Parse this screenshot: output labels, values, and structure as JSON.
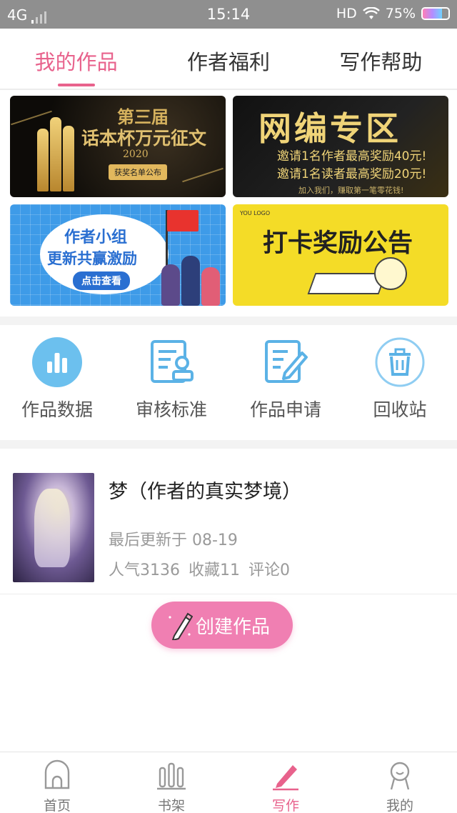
{
  "status_bar": {
    "network": "4G",
    "time": "15:14",
    "hd": "HD",
    "battery_percent": "75%",
    "battery_level": 0.75
  },
  "tabs": [
    {
      "label": "我的作品",
      "active": true
    },
    {
      "label": "作者福利",
      "active": false
    },
    {
      "label": "写作帮助",
      "active": false
    }
  ],
  "banners": {
    "contest": {
      "line1": "第三届",
      "line2": "话本杯万元征文",
      "year": "2020",
      "button": "获奖名单公布"
    },
    "editor_zone": {
      "title": "网编专区",
      "line1": "邀请1名作者最高奖励40元!",
      "line2": "邀请1名读者最高奖励20元!",
      "footer": "加入我们，赚取第一笔零花钱!"
    },
    "author_group": {
      "line1": "作者小组",
      "line2": "更新共赢激励",
      "button": "点击查看"
    },
    "checkin": {
      "title": "打卡奖励公告",
      "logo": "YOU LOGO"
    }
  },
  "tools": [
    {
      "label": "作品数据",
      "icon": "bar-chart-icon"
    },
    {
      "label": "审核标准",
      "icon": "review-doc-icon"
    },
    {
      "label": "作品申请",
      "icon": "edit-doc-icon"
    },
    {
      "label": "回收站",
      "icon": "trash-icon"
    }
  ],
  "work": {
    "title": "梦（作者的真实梦境）",
    "updated": "最后更新于 08-19",
    "popularity": "人气3136",
    "favorites": "收藏11",
    "comments": "评论0"
  },
  "create_button": {
    "label": "创建作品"
  },
  "bottom_nav": [
    {
      "label": "首页",
      "icon": "home-icon",
      "active": false
    },
    {
      "label": "书架",
      "icon": "bookshelf-icon",
      "active": false
    },
    {
      "label": "写作",
      "icon": "pencil-icon",
      "active": true
    },
    {
      "label": "我的",
      "icon": "profile-icon",
      "active": false
    }
  ],
  "colors": {
    "accent": "#e8628c",
    "icon_blue": "#5bb2e6",
    "create_button": "#f07fb2"
  }
}
